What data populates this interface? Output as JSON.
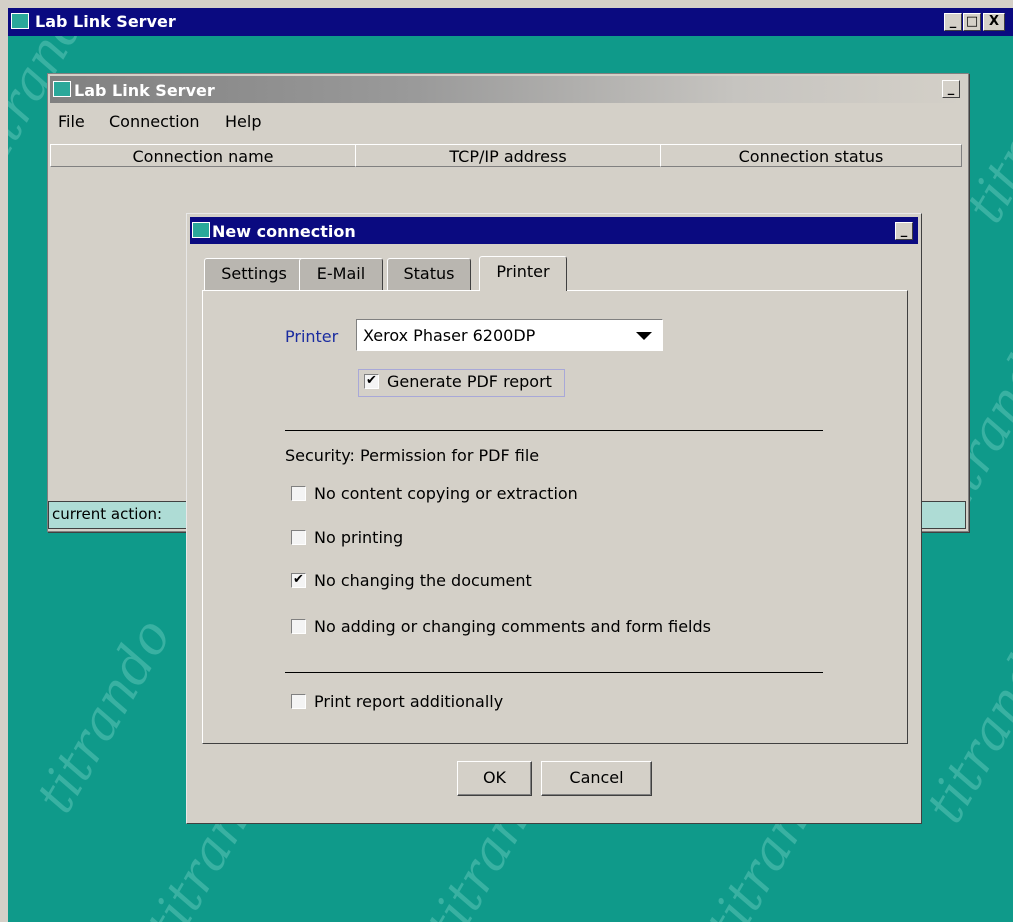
{
  "app_window": {
    "title": "Lab Link Server",
    "controls": {
      "minimize": "_",
      "maximize": "□",
      "close": "X"
    }
  },
  "desktop": {
    "watermark": "titrando",
    "accent_color": "#0f9a8a"
  },
  "inner_window": {
    "title": "Lab Link Server",
    "minimize": "_",
    "menu": [
      "File",
      "Connection",
      "Help"
    ],
    "columns": [
      "Connection name",
      "TCP/IP address",
      "Connection status"
    ],
    "status_label": "current action:"
  },
  "dialog": {
    "title": "New connection",
    "minimize": "_",
    "tabs": [
      {
        "label": "Settings",
        "active": false
      },
      {
        "label": "E-Mail",
        "active": false
      },
      {
        "label": "Status",
        "active": false
      },
      {
        "label": "Printer",
        "active": true
      }
    ],
    "printer": {
      "label": "Printer",
      "selected": "Xerox Phaser 6200DP"
    },
    "generate_pdf": {
      "label": "Generate PDF report",
      "checked": true
    },
    "security": {
      "label": "Security: Permission for PDF file",
      "options": [
        {
          "label": "No content copying or extraction",
          "checked": false
        },
        {
          "label": "No printing",
          "checked": false
        },
        {
          "label": "No changing the document",
          "checked": true
        },
        {
          "label": "No adding or changing comments and form fields",
          "checked": false
        }
      ]
    },
    "print_additionally": {
      "label": "Print report additionally",
      "checked": false
    },
    "buttons": {
      "ok": "OK",
      "cancel": "Cancel"
    }
  }
}
